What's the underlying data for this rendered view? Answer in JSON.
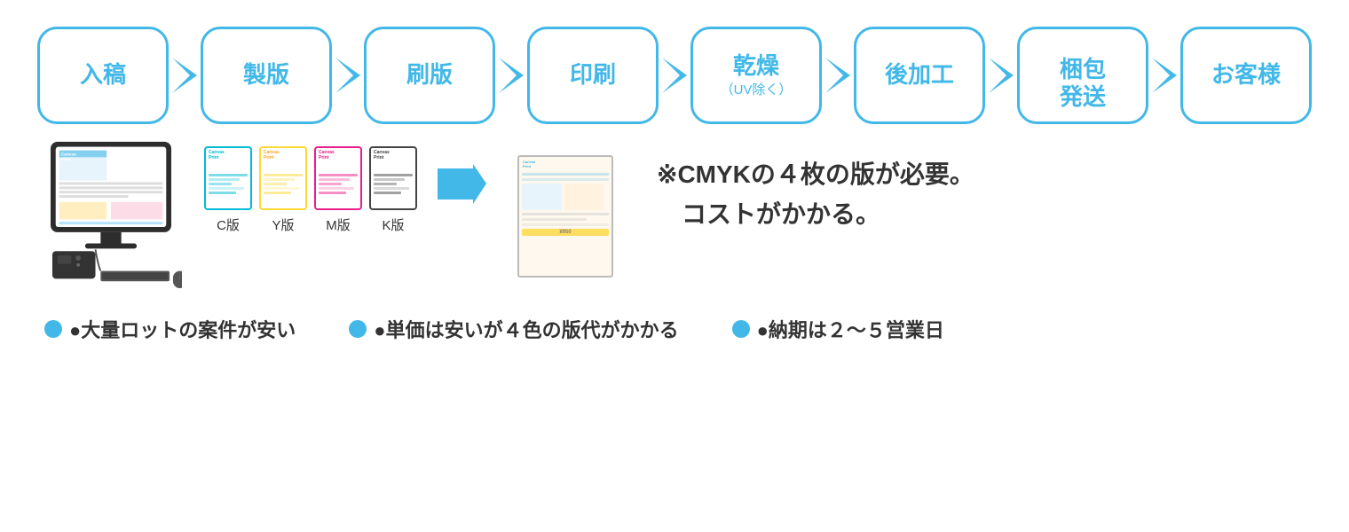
{
  "flow": {
    "steps": [
      {
        "id": "nyukou",
        "label": "入稿",
        "sub": ""
      },
      {
        "id": "seihan",
        "label": "製版",
        "sub": ""
      },
      {
        "id": "satsuban",
        "label": "刷版",
        "sub": ""
      },
      {
        "id": "insatsu",
        "label": "印刷",
        "sub": ""
      },
      {
        "id": "kanso",
        "label": "乾燥",
        "sub": "（UV除く）"
      },
      {
        "id": "kokakou",
        "label": "後加工",
        "sub": ""
      },
      {
        "id": "konpo",
        "label": "梱包\n発送",
        "sub": ""
      },
      {
        "id": "okyakusama",
        "label": "お客様",
        "sub": ""
      }
    ]
  },
  "plates": {
    "items": [
      {
        "label": "C版",
        "type": "cyan"
      },
      {
        "label": "Y版",
        "type": "yellow"
      },
      {
        "label": "M版",
        "type": "magenta"
      },
      {
        "label": "K版",
        "type": "black"
      }
    ]
  },
  "note": {
    "line1": "※CMYKの４枚の版が必要。",
    "line2": "　コストがかかる。"
  },
  "bottom": {
    "items": [
      {
        "text": "●大量ロットの案件が安い"
      },
      {
        "text": "●単価は安いが４色の版代がかかる"
      },
      {
        "text": "●納期は２〜５営業日"
      }
    ]
  }
}
